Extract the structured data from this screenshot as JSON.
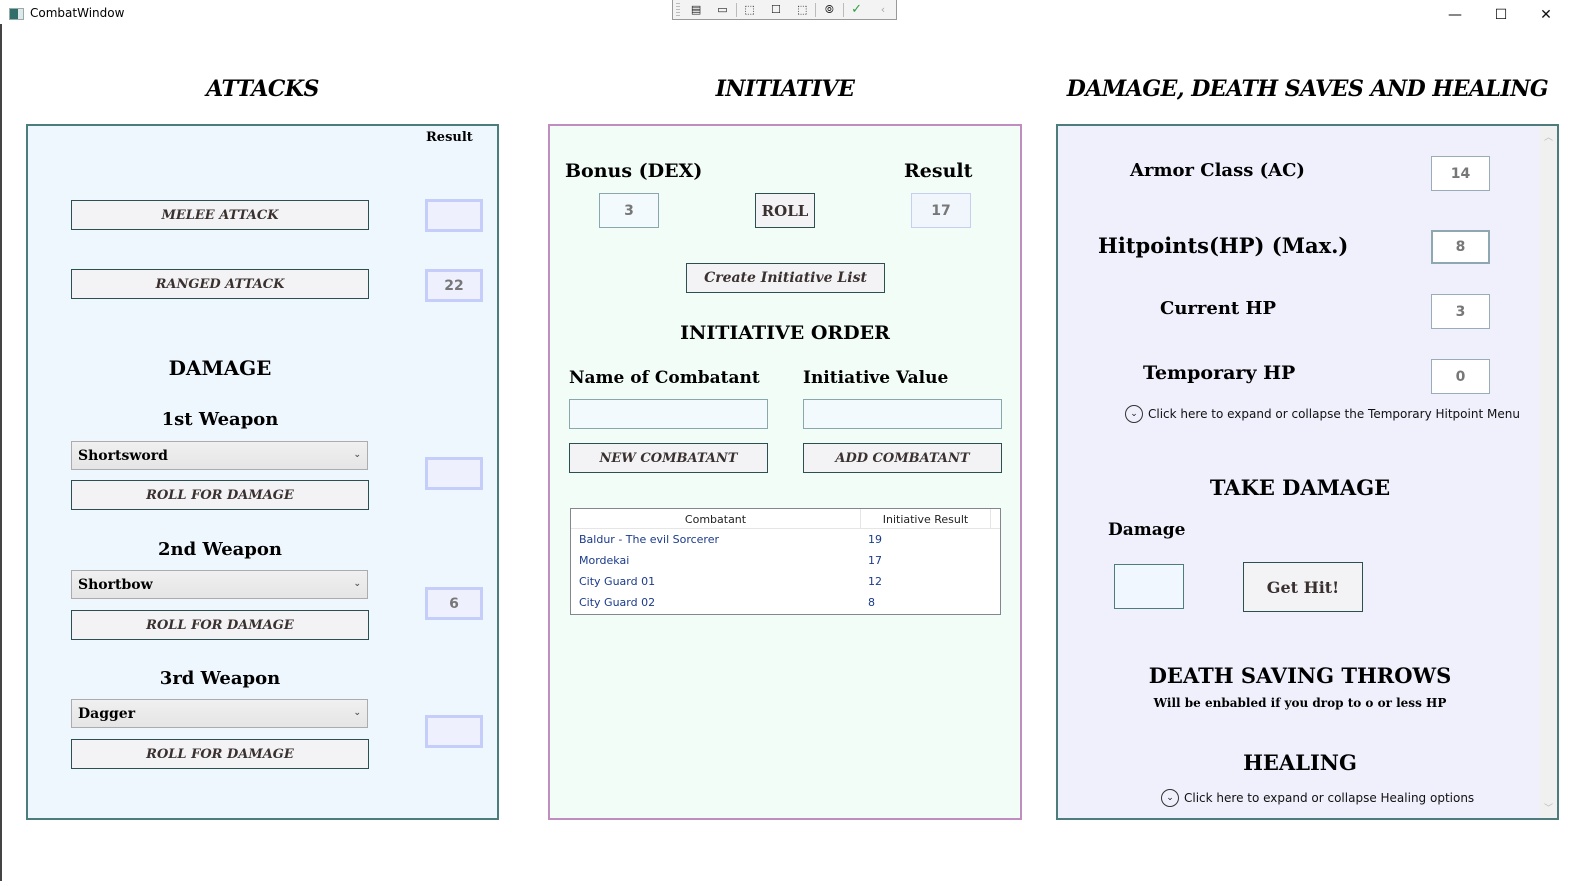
{
  "window": {
    "title": "CombatWindow",
    "controls": {
      "minimize": "—",
      "maximize": "☐",
      "close": "✕"
    }
  },
  "debug_toolbar": {
    "icons": [
      "live-visual-tree-icon",
      "record-icon",
      "select-element-icon",
      "display-layout-adorners-icon",
      "track-focused-element-icon",
      "binding-failures-icon",
      "hot-reload-ok-icon",
      "collapse-toolbar-icon"
    ],
    "glyphs": [
      "▤",
      "▭",
      "⬚",
      "☐",
      "⬚",
      "⦾",
      "✓",
      "‹"
    ]
  },
  "attacks": {
    "title": "ATTACKS",
    "result_header": "Result",
    "melee_button": "MELEE ATTACK",
    "melee_result": "",
    "ranged_button": "RANGED ATTACK",
    "ranged_result": "22",
    "damage_heading": "DAMAGE",
    "weapons": [
      {
        "label": "1st Weapon",
        "selected": "Shortsword",
        "roll_button": "ROLL FOR DAMAGE",
        "result": ""
      },
      {
        "label": "2nd Weapon",
        "selected": "Shortbow",
        "roll_button": "ROLL FOR DAMAGE",
        "result": "6"
      },
      {
        "label": "3rd Weapon",
        "selected": "Dagger",
        "roll_button": "ROLL FOR DAMAGE",
        "result": ""
      }
    ]
  },
  "initiative": {
    "title": "INITIATIVE",
    "bonus_label": "Bonus (DEX)",
    "bonus_value": "3",
    "roll_button": "ROLL",
    "result_label": "Result",
    "result_value": "17",
    "create_list_button": "Create Initiative List",
    "order_heading": "INITIATIVE ORDER",
    "name_label": "Name of Combatant",
    "name_value": "",
    "value_label": "Initiative Value",
    "value_value": "",
    "new_button": "NEW COMBATANT",
    "add_button": "ADD COMBATANT",
    "table": {
      "columns": [
        "Combatant",
        "Initiative Result"
      ],
      "rows": [
        [
          "Baldur - The evil Sorcerer",
          "19"
        ],
        [
          "Mordekai",
          "17"
        ],
        [
          "City Guard 01",
          "12"
        ],
        [
          "City Guard 02",
          "8"
        ]
      ]
    }
  },
  "damage_panel": {
    "title": "DAMAGE, DEATH SAVES AND HEALING",
    "armor_class_label": "Armor Class (AC)",
    "armor_class_value": "14",
    "max_hp_label": "Hitpoints(HP) (Max.)",
    "max_hp_value": "8",
    "current_hp_label": "Current HP",
    "current_hp_value": "3",
    "temp_hp_label": "Temporary HP",
    "temp_hp_value": "0",
    "temp_hp_expander": "Click here to expand or collapse the Temporary Hitpoint Menu",
    "take_damage_heading": "TAKE DAMAGE",
    "damage_label": "Damage",
    "damage_value": "",
    "get_hit_button": "Get Hit!",
    "death_saves_heading": "DEATH SAVING THROWS",
    "death_saves_note": "Will be enbabled if you drop to o or less HP",
    "healing_heading": "HEALING",
    "healing_expander": "Click here to expand or collapse Healing options"
  },
  "colors": {
    "attacks_bg": "#eff7fe",
    "initiative_bg": "#f3fdf8",
    "damage_bg": "#eff0fc",
    "teal_border": "#4d7c7c",
    "purple_border": "#c08dc1",
    "result_border": "#c5cdfa"
  }
}
